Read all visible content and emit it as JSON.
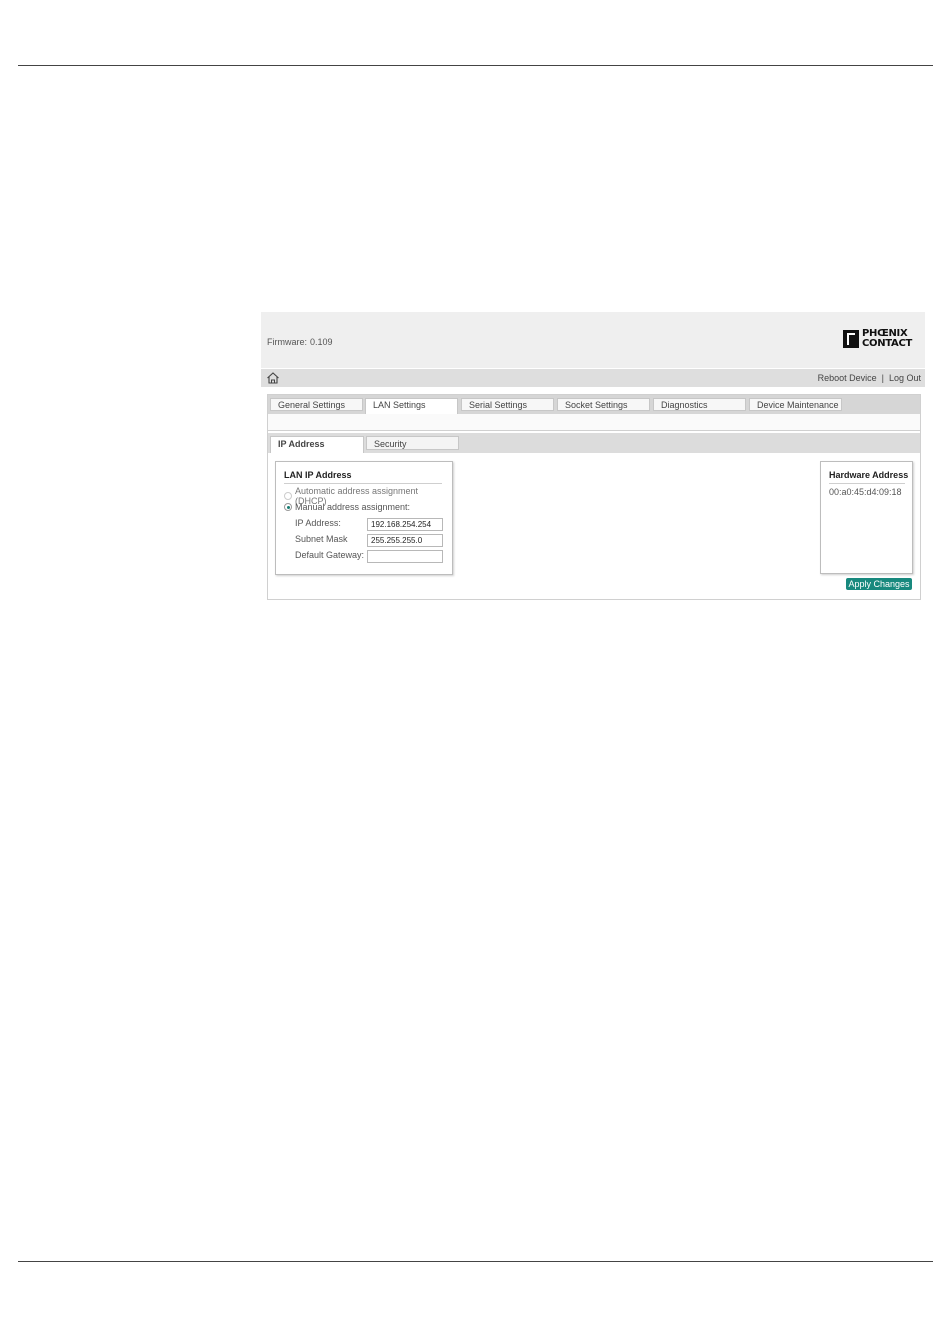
{
  "header": {
    "firmware_label": "Firmware:",
    "firmware_value": "0.109",
    "logo_line1": "PHŒNIX",
    "logo_line2": "CONTACT"
  },
  "nav": {
    "reboot_label": "Reboot Device",
    "separator": "|",
    "logout_label": "Log Out"
  },
  "tabs": [
    {
      "label": "General Settings"
    },
    {
      "label": "LAN Settings"
    },
    {
      "label": "Serial Settings"
    },
    {
      "label": "Socket Settings"
    },
    {
      "label": "Diagnostics"
    },
    {
      "label": "Device Maintenance"
    }
  ],
  "active_tab": "LAN Settings",
  "subtabs": [
    {
      "label": "IP Address"
    },
    {
      "label": "Security"
    }
  ],
  "active_subtab": "IP Address",
  "lan_ip": {
    "title": "LAN IP Address",
    "auto_label": "Automatic address assignment (DHCP)",
    "manual_label": "Manual address assignment:",
    "selected_mode": "manual",
    "ip_label": "IP Address:",
    "ip_value": "192.168.254.254",
    "subnet_label": "Subnet Mask",
    "subnet_value": "255.255.255.0",
    "gateway_label": "Default Gateway:",
    "gateway_value": ""
  },
  "hardware": {
    "title": "Hardware Address",
    "value": "00:a0:45:d4:09:18"
  },
  "apply_label": "Apply Changes",
  "colors": {
    "accent": "#18897e",
    "header_bg": "#efefef",
    "nav_bg": "#dedede"
  }
}
